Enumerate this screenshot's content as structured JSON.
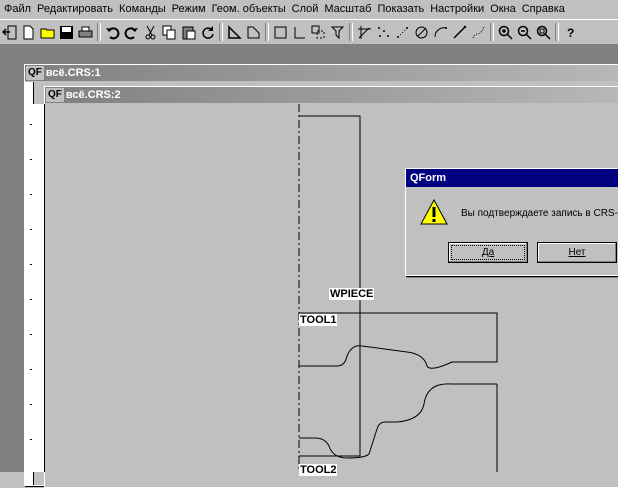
{
  "menu": [
    "Файл",
    "Редактировать",
    "Команды",
    "Режим",
    "Геом. объекты",
    "Слой",
    "Масштаб",
    "Показать",
    "Настройки",
    "Окна",
    "Справка"
  ],
  "toolbar_icons": [
    "exit-icon",
    "new-file-icon",
    "open-folder-icon",
    "save-icon",
    "print-icon",
    "undo-icon",
    "redo-icon",
    "cut-icon",
    "copy-icon",
    "paste-icon",
    "refresh-icon",
    "polygon-icon",
    "polygon-outline-icon",
    "rectangle-icon",
    "corner-icon",
    "move-icon",
    "arrow-down-icon",
    "cross-icon",
    "dots-icon",
    "point-icon",
    "circle-icon",
    "arc-icon",
    "line-icon",
    "curve-icon",
    "zoom-in-icon",
    "zoom-out-icon",
    "zoom-fit-icon",
    "help-icon"
  ],
  "windows": {
    "win1": {
      "logo": "QF",
      "title": "всё.CRS:1"
    },
    "win2": {
      "logo": "QF",
      "title": "всё.CRS:2"
    }
  },
  "drawing": {
    "labels": [
      "WPIECE",
      "TOOL1",
      "TOOL2"
    ]
  },
  "dialog": {
    "title": "QForm",
    "message": "Вы подтверждаете запись в CRS-",
    "yes": "Да",
    "no": "Нет"
  },
  "colors": {
    "dialog_title": "#000080",
    "background": "#c0c0c0"
  }
}
